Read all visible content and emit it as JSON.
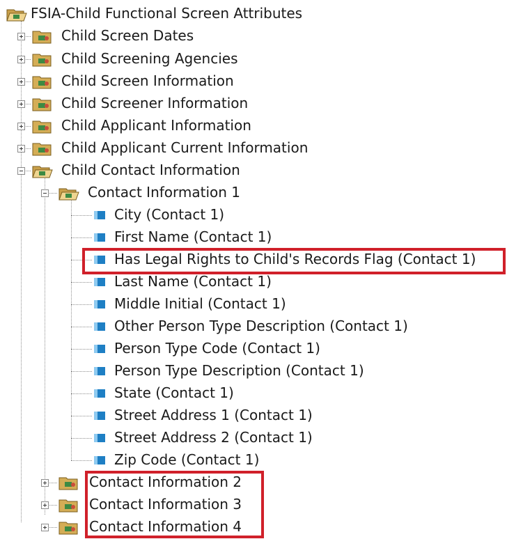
{
  "tree": {
    "root": {
      "label": "FSIA-Child Functional Screen Attributes",
      "icon": "open-folder-icon"
    },
    "groups": [
      {
        "label": "Child Screen Dates",
        "expanded": false
      },
      {
        "label": "Child Screening Agencies",
        "expanded": false
      },
      {
        "label": "Child Screen Information",
        "expanded": false
      },
      {
        "label": "Child Screener Information",
        "expanded": false
      },
      {
        "label": "Child Applicant Information",
        "expanded": false
      },
      {
        "label": "Child Applicant Current Information",
        "expanded": false
      },
      {
        "label": "Child Contact Information",
        "expanded": true
      }
    ],
    "contact_1": {
      "label": "Contact Information 1",
      "fields": [
        "City (Contact 1)",
        "First Name (Contact 1)",
        "Has Legal Rights to Child's Records Flag (Contact 1)",
        "Last Name (Contact 1)",
        "Middle Initial (Contact 1)",
        "Other Person Type Description (Contact 1)",
        "Person Type Code (Contact 1)",
        "Person Type Description (Contact 1)",
        "State (Contact 1)",
        "Street Address 1 (Contact 1)",
        "Street Address 2 (Contact 1)",
        "Zip Code (Contact 1)"
      ]
    },
    "other_contacts": [
      "Contact Information 2",
      "Contact Information 3",
      "Contact Information 4"
    ]
  },
  "colors": {
    "highlight": "#d0202a",
    "field_icon": "#1e7fc4",
    "folder": "#c8a24a"
  }
}
